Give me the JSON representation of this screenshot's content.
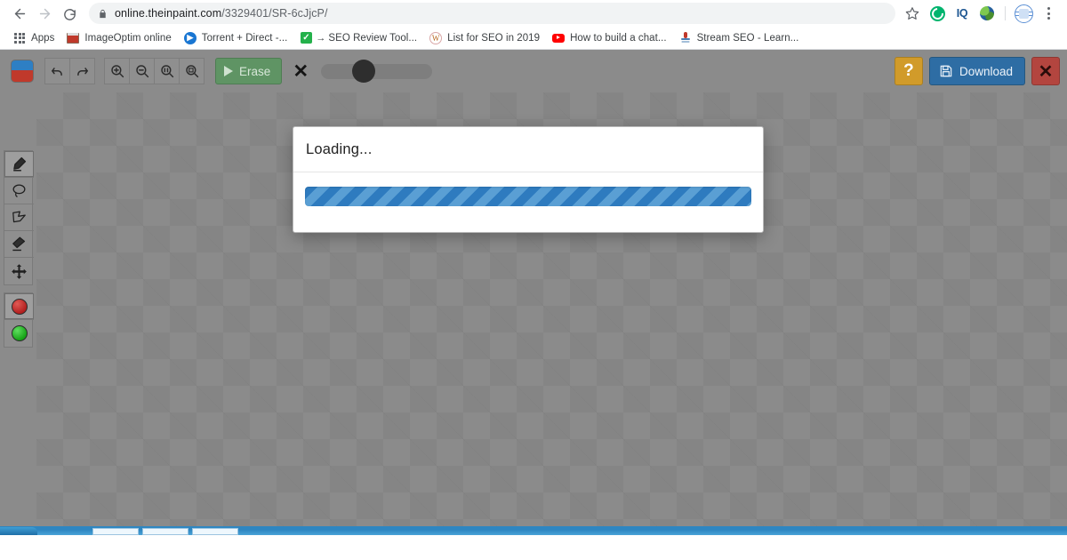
{
  "browser": {
    "url_display": "online.theinpaint.com/3329401/SR-6cJjcP/",
    "url_domain": "online.theinpaint.com",
    "url_path": "/3329401/SR-6cJjcP/",
    "back_label": "Back",
    "forward_label": "Forward",
    "reload_label": "Reload",
    "lock_icon": "lock-icon",
    "bookmark_star_icon": "star-icon",
    "extensions": [
      {
        "name": "grammarly-extension-icon",
        "label": "G"
      },
      {
        "name": "iq-extension-icon",
        "label": "IQ"
      },
      {
        "name": "globe-extension-icon",
        "label": ""
      },
      {
        "name": "seo-meter-extension-icon",
        "label": ""
      }
    ],
    "menu_icon": "kebab-menu-icon",
    "bookmarks": [
      {
        "label": "Apps",
        "icon": "apps-grid-icon"
      },
      {
        "label": "ImageOptim online",
        "icon": "imageoptim-favicon"
      },
      {
        "label": "Torrent + Direct -...",
        "icon": "torrent-favicon"
      },
      {
        "label": "SEO Review Tool...",
        "icon": "checkmark-favicon",
        "prefix": "→"
      },
      {
        "label": "List for SEO in 2019",
        "icon": "wikipedia-favicon"
      },
      {
        "label": "How to build a chat...",
        "icon": "youtube-favicon"
      },
      {
        "label": "Stream SEO - Learn...",
        "icon": "streamseo-favicon"
      }
    ]
  },
  "app": {
    "logo_name": "inpaint-logo",
    "toolbar": {
      "undo_label": "Undo",
      "redo_label": "Redo",
      "zoom_in_label": "Zoom In",
      "zoom_out_label": "Zoom Out",
      "zoom_actual_label": "Actual Size 1:1",
      "zoom_fit_label": "Fit to Screen",
      "erase_label": "Erase",
      "clear_label": "✕",
      "brush_size_value": "30",
      "help_label": "?",
      "download_label": "Download",
      "close_label": "✕"
    },
    "palette": {
      "tools": [
        {
          "name": "marker-tool",
          "label": "Marker",
          "active": true
        },
        {
          "name": "lasso-tool",
          "label": "Lasso",
          "active": false
        },
        {
          "name": "polygon-lasso-tool",
          "label": "Polygon Lasso",
          "active": false
        },
        {
          "name": "eraser-tool",
          "label": "Eraser",
          "active": false
        },
        {
          "name": "move-tool",
          "label": "Move",
          "active": false
        }
      ],
      "colors": [
        {
          "name": "red-swatch",
          "hex": "#b3201f",
          "selected": true
        },
        {
          "name": "green-swatch",
          "hex": "#17a317",
          "selected": false
        }
      ]
    },
    "modal": {
      "title": "Loading...",
      "progress_state": "indeterminate",
      "progress_percent": 100
    }
  },
  "colors": {
    "app_chrome": "#8b8b8b",
    "erase_green": "#5f9464",
    "download_blue": "#2e6da4",
    "help_gold": "#d19b2a",
    "close_red": "#b3453f",
    "progress_dark": "#2e7bbf",
    "progress_light": "#5a9fd4",
    "taskbar_blue": "#2e86c1"
  }
}
